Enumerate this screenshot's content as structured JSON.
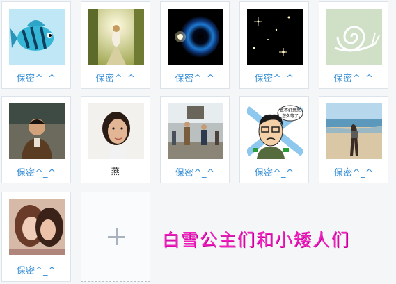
{
  "cards": [
    {
      "caption": "保密^_^",
      "icon": "fish-photo"
    },
    {
      "caption": "保密^_^",
      "icon": "girl-sunlight-photo"
    },
    {
      "caption": "保密^_^",
      "icon": "blue-nebula-photo"
    },
    {
      "caption": "保密^_^",
      "icon": "starfield-photo"
    },
    {
      "caption": "保密^_^",
      "icon": "snail-sketch-photo"
    },
    {
      "caption": "保密^_^",
      "icon": "man-portrait-photo"
    },
    {
      "caption": "燕",
      "icon": "woman-portrait-photo"
    },
    {
      "caption": "保密^_^",
      "icon": "street-group-photo"
    },
    {
      "caption": "保密^_^",
      "icon": "cartoon-man-avatar"
    },
    {
      "caption": "保密^_^",
      "icon": "beach-woman-photo"
    },
    {
      "caption": "保密^_^",
      "icon": "two-girls-selfie-photo"
    }
  ],
  "cartoon_speech": "真不好意思\n让您久等了。",
  "banner_text": "白雪公主们和小矮人们",
  "add_button": {
    "icon": "plus-icon"
  },
  "colors": {
    "caption": "#3a90d6",
    "banner": "#f01fbd",
    "border": "#dde3ea"
  }
}
